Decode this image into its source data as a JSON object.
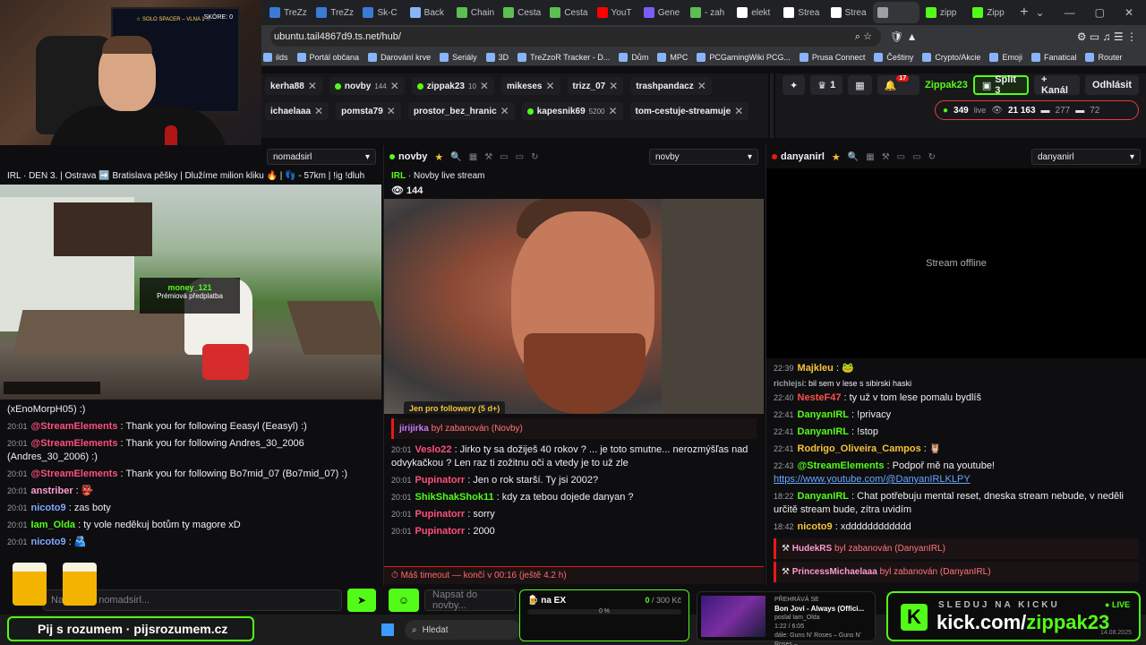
{
  "browser": {
    "tabs": [
      {
        "label": "TreZz",
        "color": "#3a7bd5"
      },
      {
        "label": "TreZz",
        "color": "#3a7bd5"
      },
      {
        "label": "Sk-C",
        "color": "#3a7bd5"
      },
      {
        "label": "Back",
        "color": "#8ab4f8"
      },
      {
        "label": "Chain",
        "color": "#5bbf52"
      },
      {
        "label": "Cesta",
        "color": "#5bbf52"
      },
      {
        "label": "Cesta",
        "color": "#5bbf52"
      },
      {
        "label": "YouT",
        "color": "#ff0000"
      },
      {
        "label": "Gene",
        "color": "#7c5cff"
      },
      {
        "label": "- zah",
        "color": "#5bbf52"
      },
      {
        "label": "elekt",
        "color": "#ffffff"
      },
      {
        "label": "Strea",
        "color": "#ffffff"
      },
      {
        "label": "Strea",
        "color": "#ffffff"
      },
      {
        "label": "",
        "color": "#9aa0a6"
      },
      {
        "label": "zipp",
        "color": "#53fc18"
      },
      {
        "label": "Zipp",
        "color": "#53fc18"
      }
    ],
    "url": "ubuntu.tail4867d9.ts.net/hub/",
    "bookmarks": [
      "ilds",
      "Portál občana",
      "Darování krve",
      "Seriály",
      "3D",
      "TreZzoR Tracker - D...",
      "Dům",
      "MPC",
      "PCGamingWiki PCG...",
      "Prusa Connect",
      "Češtiny",
      "Crypto/Akcie",
      "Emoji",
      "Fanatical",
      "Router"
    ]
  },
  "webcam": {
    "score": "SKÓRE: 0",
    "top_text": "☆ SOLO SPACER – VLNA 1 ☆"
  },
  "chips_row1": [
    {
      "name": "kerha88",
      "count": "",
      "dot": ""
    },
    {
      "name": "novby",
      "count": "144",
      "dot": "#53fc18"
    },
    {
      "name": "zippak23",
      "count": "10",
      "dot": "#53fc18"
    },
    {
      "name": "mikeses",
      "count": "",
      "dot": ""
    },
    {
      "name": "trizz_07",
      "count": "",
      "dot": ""
    },
    {
      "name": "trashpandacz",
      "count": "",
      "dot": ""
    }
  ],
  "chips_row2": [
    {
      "name": "ichaelaaa",
      "count": "",
      "dot": ""
    },
    {
      "name": "pomsta79",
      "count": "",
      "dot": ""
    },
    {
      "name": "prostor_bez_hranic",
      "count": "",
      "dot": ""
    },
    {
      "name": "kapesnik69",
      "count": "5200",
      "dot": "#53fc18"
    },
    {
      "name": "tom-cestuje-streamuje",
      "count": "",
      "dot": ""
    }
  ],
  "topright": {
    "crown_count": "1",
    "notif_badge": "17",
    "user": "Zippak23",
    "split_label": "Split 3",
    "kanal_label": "+ Kanál",
    "logout_label": "Odhlásit",
    "live_count": "349",
    "live_label": "live",
    "viewers": "21 163",
    "cz1": "277",
    "cz2": "72"
  },
  "panel1": {
    "channel": "nomadsirl",
    "title": "IRL · DEN 3. | Ostrava ➡️ Bratislava pěšky | Dlužíme milion kliku 🔥 | 👣 - 57km | !ig !dluh",
    "overlay_name": "money_121",
    "overlay_sub": "Prémiová předplatba",
    "chat": [
      {
        "t": "",
        "n": "",
        "c": "",
        "m": "(xEnoMorpH05) :)"
      },
      {
        "t": "20:01",
        "n": "@StreamElements",
        "c": "#ff4f7c",
        "m": " : Thank you for following Eeasyl (Eeasyl) :)"
      },
      {
        "t": "20:01",
        "n": "@StreamElements",
        "c": "#ff4f7c",
        "m": " : Thank you for following Andres_30_2006 (Andres_30_2006) :)"
      },
      {
        "t": "20:01",
        "n": "@StreamElements",
        "c": "#ff4f7c",
        "m": " : Thank you for following Bo7mid_07 (Bo7mid_07) :)"
      },
      {
        "t": "20:01",
        "n": "anstriber",
        "c": "#ff9bd2",
        "m": " : 👺"
      },
      {
        "t": "20:01",
        "n": "nicoto9",
        "c": "#7fa8ff",
        "m": " : zas boty"
      },
      {
        "t": "20:01",
        "n": "Iam_Olda",
        "c": "#53fc18",
        "m": " : ty vole neděkuj botům ty magore xD"
      },
      {
        "t": "20:01",
        "n": "nicoto9",
        "c": "#7fa8ff",
        "m": " : 🫂"
      }
    ],
    "input_placeholder": "Napsat do nomadsirl..."
  },
  "panel2": {
    "channel": "novby",
    "title_prefix": "IRL",
    "title": " · Novby live stream",
    "viewers": "144",
    "follow_text": "Jen pro followery (5 d+)",
    "chat": [
      {
        "t": "",
        "n": "jirijirka",
        "c": "#c77dff",
        "m": " byl zabanován (Novby)",
        "ban": true
      },
      {
        "t": "20:01",
        "n": "Veslo22",
        "c": "#ff4f7c",
        "m": " : Jirko ty sa dožiješ 40 rokov ? ... je toto smutne... nerozmýšľas nad odvykačkou ? Len raz ti zožitnu oči a vtedy je to už zle"
      },
      {
        "t": "20:01",
        "n": "Pupinatorr",
        "c": "#ff4f7c",
        "m": " : Jen o rok starší. Ty jsi 2002?"
      },
      {
        "t": "20:01",
        "n": "ShikShakShok11",
        "c": "#53fc18",
        "m": " : kdy za tebou dojede danyan ?"
      },
      {
        "t": "20:01",
        "n": "Pupinatorr",
        "c": "#ff4f7c",
        "m": " : sorry"
      },
      {
        "t": "20:01",
        "n": "Pupinatorr",
        "c": "#ff4f7c",
        "m": " : 2000"
      }
    ],
    "timeout_text": "⏱ Máš timeout — končí v 00:16 (ještě 4.2 h)",
    "input_placeholder": "Napsat do novby..."
  },
  "panel3": {
    "channel": "danyanirl",
    "offline_text": "Stream offline",
    "chat": [
      {
        "t": "22:39",
        "n": "Majkleu",
        "c": "#f7c338",
        "m": " : 🐸"
      },
      {
        "t": "",
        "n": "richlejsi",
        "c": "#9b9ba4",
        "m": ": bil sem v lese s sibirski haski",
        "small": true
      },
      {
        "t": "22:40",
        "n": "NesteF47",
        "c": "#ff4f4f",
        "m": " : ty už v tom lese pomalu bydlíš"
      },
      {
        "t": "22:41",
        "n": "DanyanIRL",
        "c": "#53fc18",
        "m": " : !privacy"
      },
      {
        "t": "22:41",
        "n": "DanyanIRL",
        "c": "#53fc18",
        "m": " : !stop"
      },
      {
        "t": "22:41",
        "n": "Rodrigo_Oliveira_Campos",
        "c": "#f7c338",
        "m": " : 🦉"
      },
      {
        "t": "22:43",
        "n": "@StreamElements",
        "c": "#53fc18",
        "m": " : Podpoř mě na youtube! ",
        "link": "https://www.youtube.com/@DanyanIRLKLPY"
      },
      {
        "t": "18:22",
        "n": "DanyanIRL",
        "c": "#53fc18",
        "m": " : Chat potřebuju mental reset, dneska stream nebude, v neděli určitě stream bude, zítra uvidím"
      },
      {
        "t": "18:42",
        "n": "nicoto9",
        "c": "#f7c338",
        "m": " : xdddddddddddd"
      }
    ],
    "bans": [
      {
        "n": "HudekRS",
        "m": " byl zabanován (DanyanIRL)"
      },
      {
        "n": "PrincessMichaelaaa",
        "m": " byl zabanován (DanyanIRL)"
      }
    ]
  },
  "taskbar": {
    "search": "Hledat"
  },
  "promo": {
    "pij": "Pij s rozumem · pijsrozumem.cz",
    "ex_label": "na EX",
    "ex_current": "0",
    "ex_target": "/ 300 Kč",
    "ex_pct": "0 %",
    "song_label": "PŘEHRÁVÁ SE",
    "song_title": "Bon Jovi - Always (Offici...",
    "song_by": "poslal Iam_Olda",
    "song_time": "1:22 / 6:05",
    "song_next": "dále: Guns N' Roses – Guns N' Roses –",
    "kick_cta": "SLEDUJ NA KICKU",
    "kick_url_prefix": "kick.com/",
    "kick_url_user": "zippak23",
    "kick_live": "● LIVE",
    "kick_date": "14.08.2025"
  }
}
